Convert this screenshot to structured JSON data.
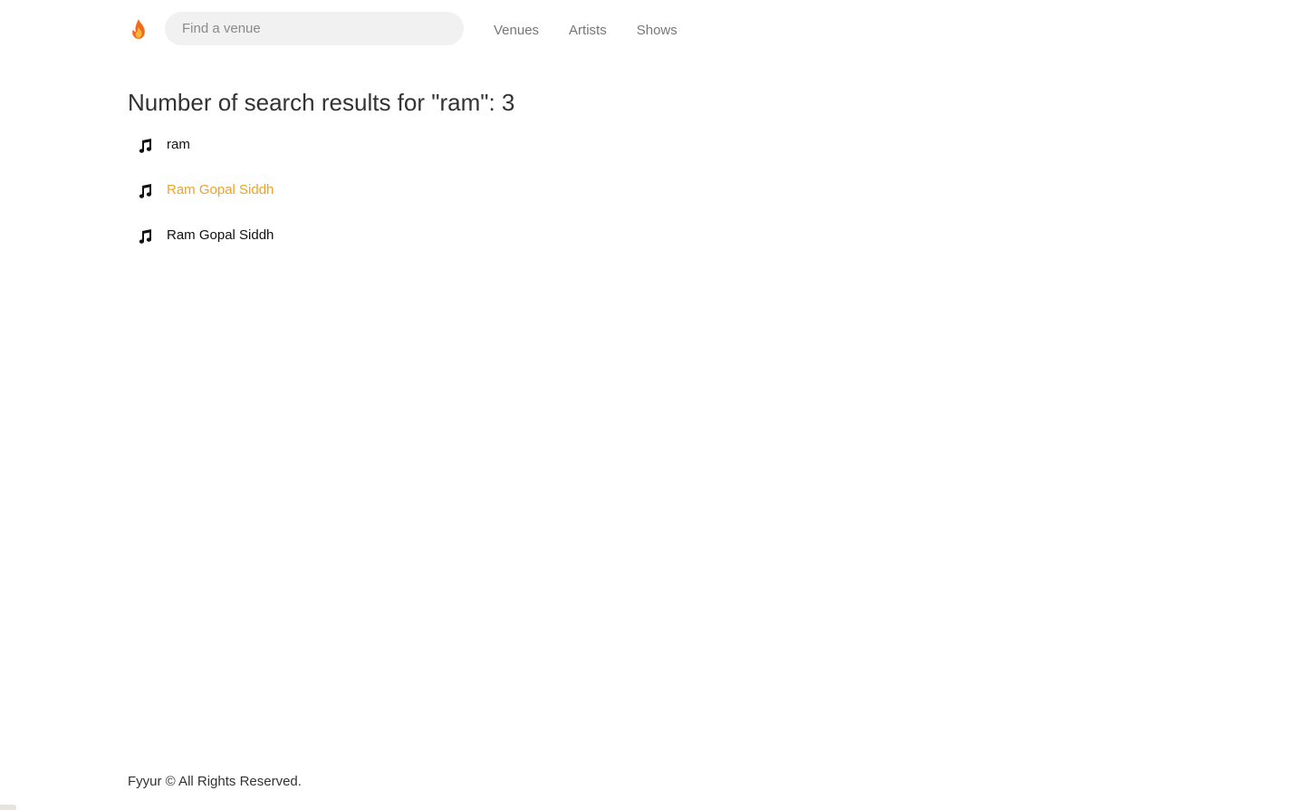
{
  "navbar": {
    "brand_icon": "fire-icon",
    "search": {
      "placeholder": "Find a venue",
      "value": ""
    },
    "links": [
      "Venues",
      "Artists",
      "Shows"
    ]
  },
  "results": {
    "title_prefix": "Number of search results for \"ram\": ",
    "count": "3",
    "items": [
      {
        "icon": "music-note-icon",
        "label": "ram"
      },
      {
        "icon": "music-note-icon",
        "label": "Ram Gopal Siddh"
      },
      {
        "icon": "music-note-icon",
        "label": "Ram Gopal Siddh"
      }
    ]
  },
  "footer": {
    "text": "Fyyur © All Rights Reserved."
  },
  "colors": {
    "accent": "#f0a325",
    "text": "#333333",
    "nav_text": "#777777",
    "search_bg": "#f1f1f1"
  }
}
